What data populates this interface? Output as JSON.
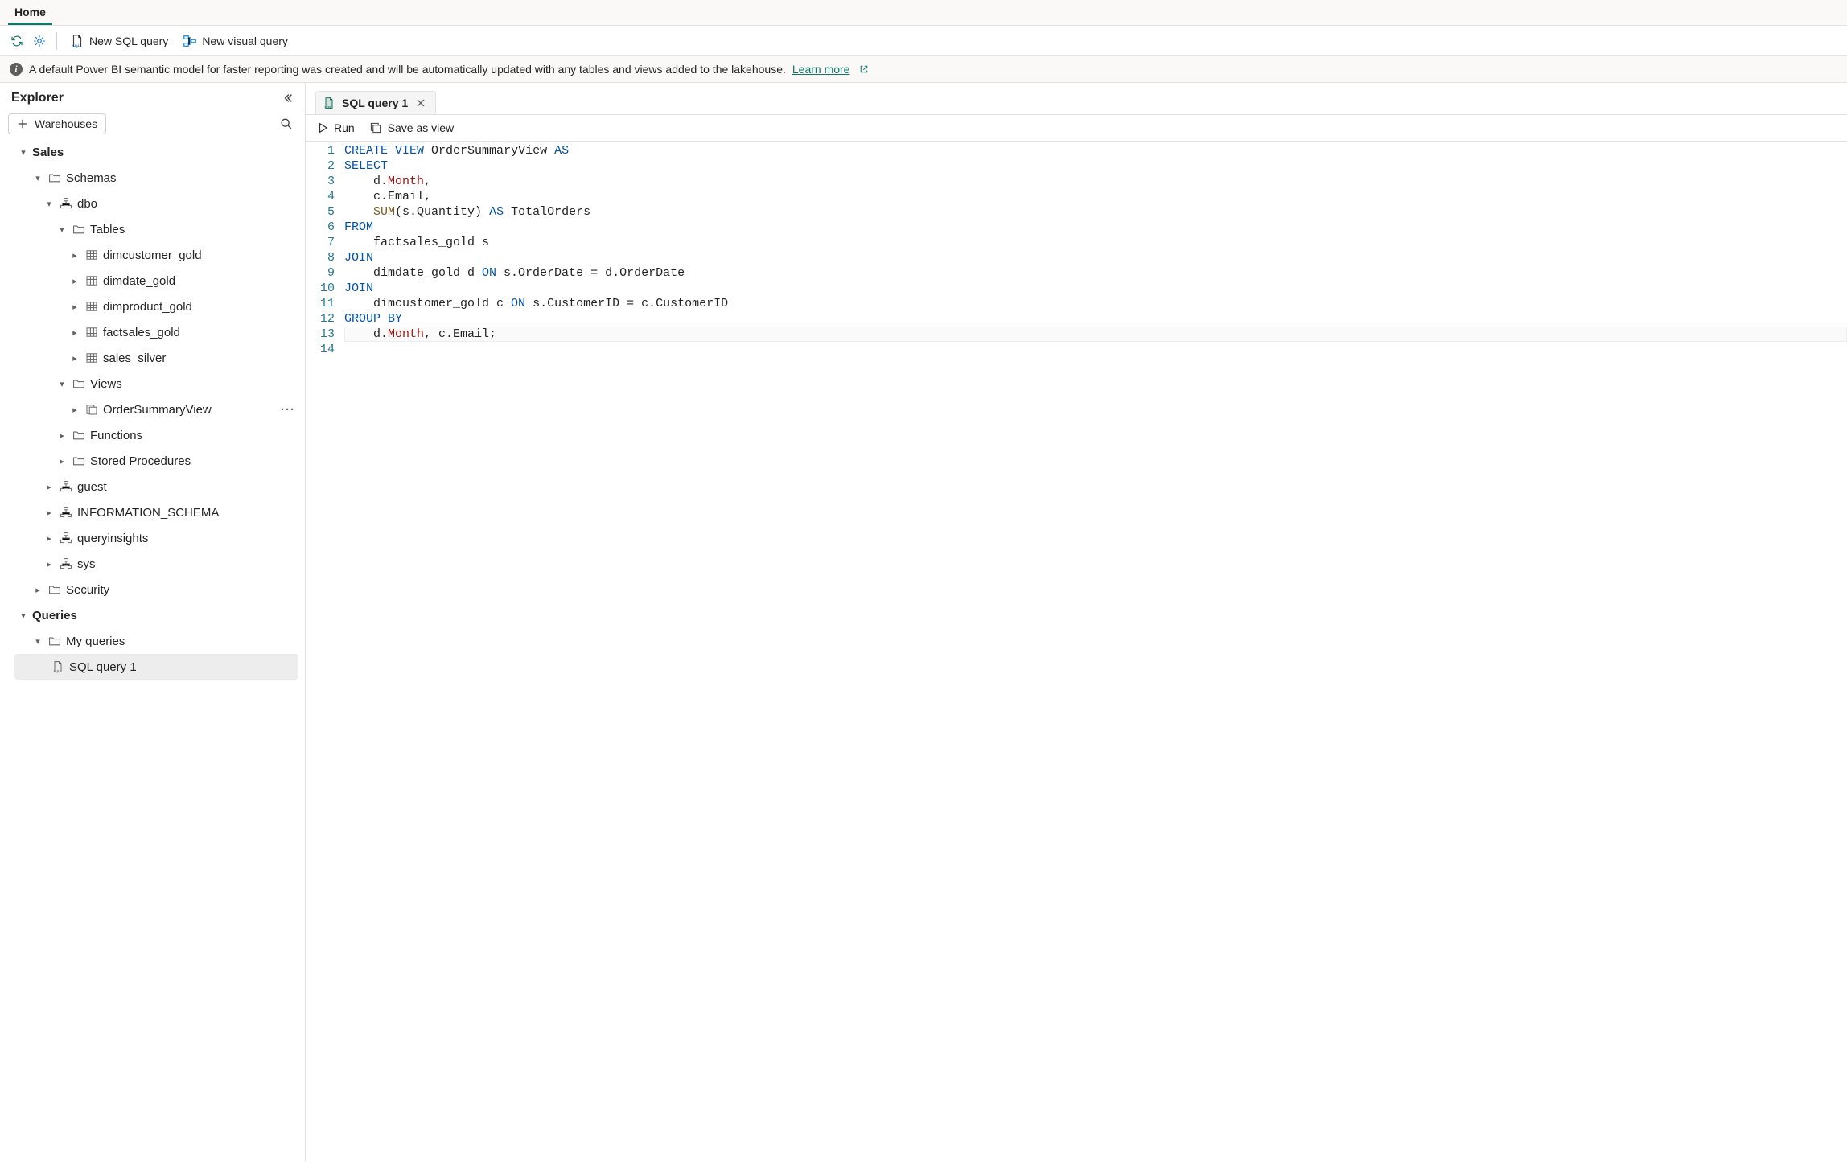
{
  "tabs": {
    "home": "Home"
  },
  "ribbon": {
    "newSql": "New SQL query",
    "newVisual": "New visual query"
  },
  "banner": {
    "text": "A default Power BI semantic model for faster reporting was created and will be automatically updated with any tables and views added to the lakehouse. ",
    "link": "Learn more"
  },
  "explorer": {
    "title": "Explorer",
    "warehouses": "Warehouses",
    "tree": {
      "sales": "Sales",
      "schemas": "Schemas",
      "dbo": "dbo",
      "tables": "Tables",
      "t_dimcustomer": "dimcustomer_gold",
      "t_dimdate": "dimdate_gold",
      "t_dimproduct": "dimproduct_gold",
      "t_factsales": "factsales_gold",
      "t_salessilver": "sales_silver",
      "views": "Views",
      "v_ordersummary": "OrderSummaryView",
      "functions": "Functions",
      "sprocs": "Stored Procedures",
      "guest": "guest",
      "infoschema": "INFORMATION_SCHEMA",
      "queryinsights": "queryinsights",
      "sys": "sys",
      "security": "Security",
      "queries": "Queries",
      "myqueries": "My queries",
      "sql1": "SQL query 1"
    }
  },
  "editor": {
    "tab": "SQL query 1",
    "run": "Run",
    "saveAsView": "Save as view",
    "lineNumbers": [
      "1",
      "2",
      "3",
      "4",
      "5",
      "6",
      "7",
      "8",
      "9",
      "10",
      "11",
      "12",
      "13",
      "14"
    ]
  }
}
